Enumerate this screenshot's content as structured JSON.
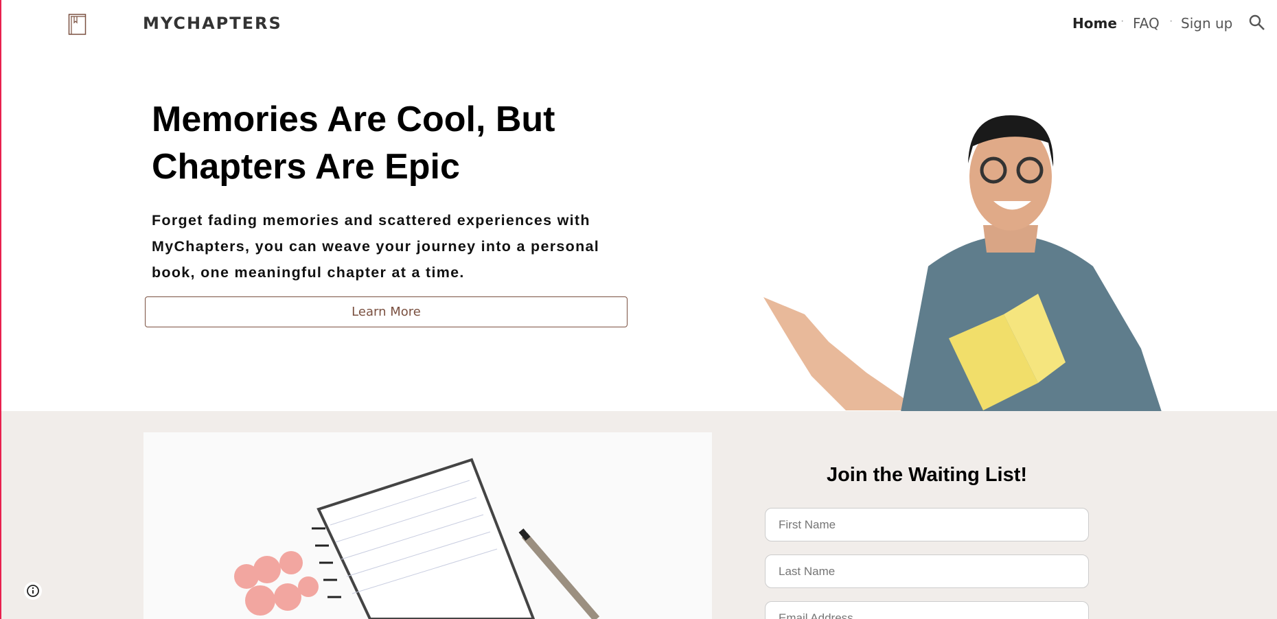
{
  "header": {
    "site_title": "MYCHAPTERS",
    "logo_icon": "book-icon",
    "nav": [
      {
        "label": "Home",
        "active": true
      },
      {
        "label": "FAQ"
      },
      {
        "label": "Sign up"
      }
    ],
    "separator": "·",
    "search_icon": "search-icon"
  },
  "hero": {
    "title_line1": "Memories Are Cool, But",
    "title_line2": "Chapters Are Epic",
    "text": "Forget fading memories and scattered experiences with MyChapters, you can weave your journey into a personal book, one meaningful chapter at a time.",
    "button_label": "Learn More",
    "accent": "#7a5040"
  },
  "waitlist": {
    "title": "Join the Waiting List!",
    "fields": [
      {
        "placeholder": "First Name",
        "value": ""
      },
      {
        "placeholder": "Last Name",
        "value": ""
      },
      {
        "placeholder": "Email Address",
        "value": ""
      }
    ]
  },
  "colors": {
    "section_bg": "#f1edea",
    "brand": "#7a5040"
  }
}
